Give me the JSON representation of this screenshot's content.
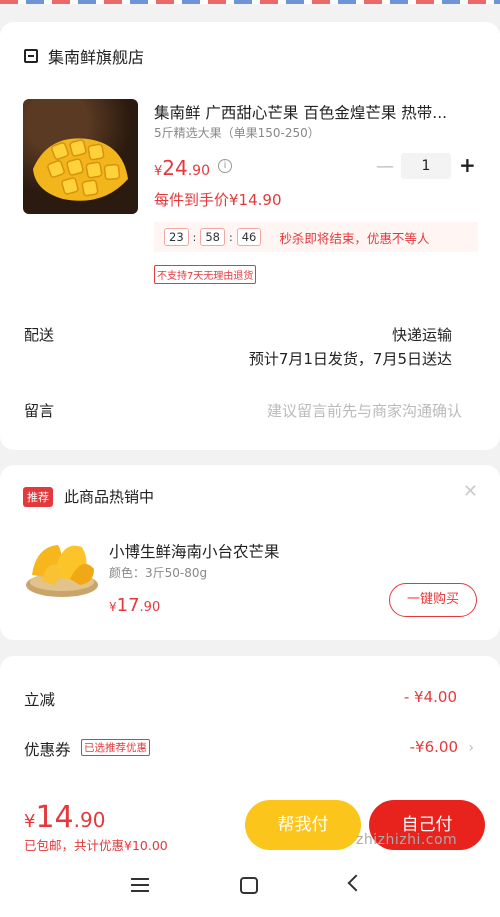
{
  "shop": {
    "name": "集南鲜旗舰店"
  },
  "product": {
    "title": "集南鲜 广西甜心芒果 百色金煌芒果 热带...",
    "spec": "5斤精选大果（单果150-250）",
    "price_symbol": "¥",
    "price_int": "24",
    "price_dec": ".90",
    "quantity": "1",
    "deal_price": "每件到手价¥14.90",
    "countdown": {
      "h": "23",
      "m": "58",
      "s": "46",
      "text": "秒杀即将结束，优惠不等人"
    },
    "no_return": "不支持7天无理由退货"
  },
  "delivery": {
    "label": "配送",
    "method": "快递运输",
    "schedule": "预计7月1日发货，7月5日送达"
  },
  "message": {
    "label": "留言",
    "placeholder": "建议留言前先与商家沟通确认"
  },
  "recommend": {
    "tag": "推荐",
    "heading": "此商品热销中",
    "title": "小博生鲜海南小台农芒果",
    "spec": "颜色：3斤50-80g",
    "price_symbol": "¥",
    "price_int": "17",
    "price_dec": ".90",
    "button": "一键购买"
  },
  "pricing": {
    "discount_label": "立减",
    "discount_value": "- ¥4.00",
    "coupon_label": "优惠券",
    "coupon_tag": "已选推荐优惠",
    "coupon_value": "-¥6.00"
  },
  "checkout": {
    "total_symbol": "¥",
    "total_int": "14",
    "total_dec": ".90",
    "shipping": "已包邮，共计优惠¥10.00",
    "help_pay": "帮我付",
    "self_pay": "自己付"
  },
  "watermark": "zhizhizhi.com",
  "colors": {
    "accent": "#e4393c",
    "help_btn": "#fcc51b",
    "pay_btn": "#e8231d"
  }
}
